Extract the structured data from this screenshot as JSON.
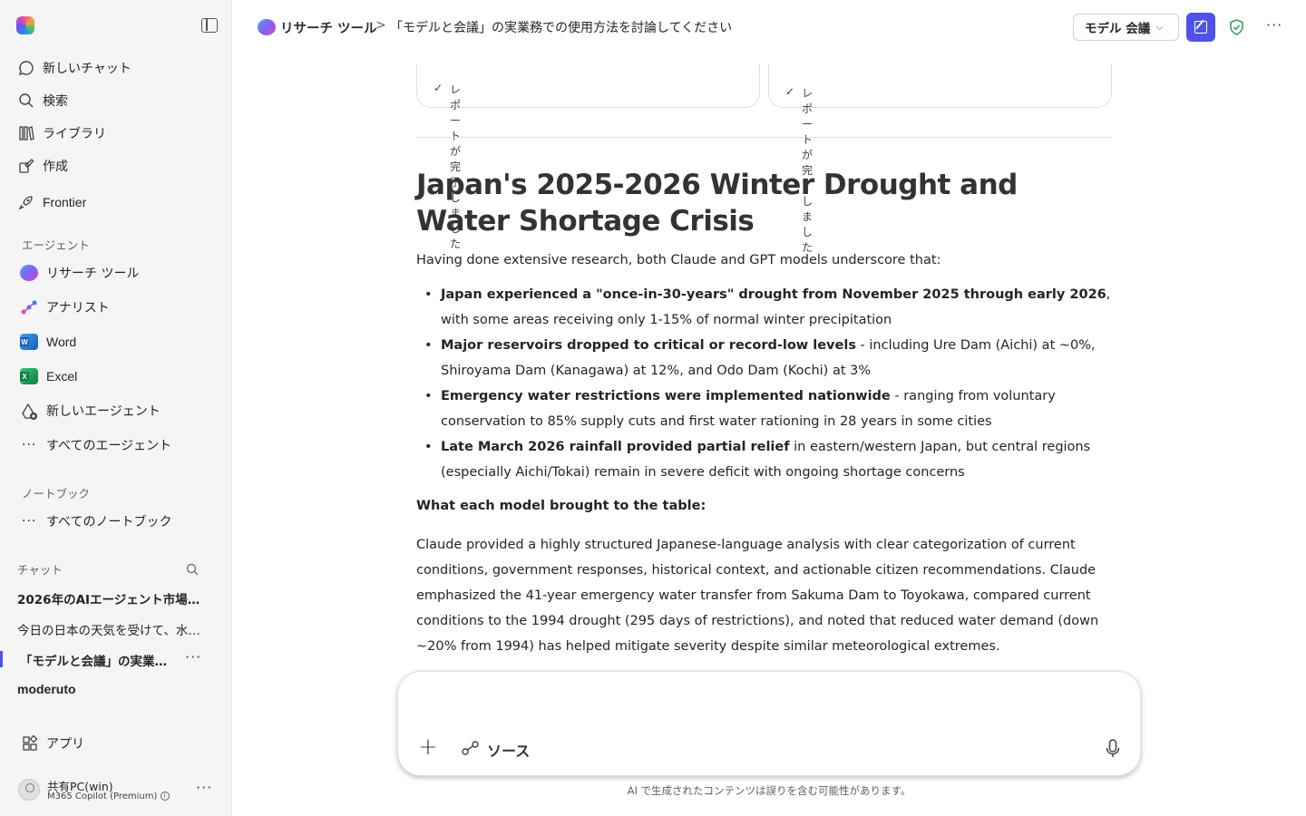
{
  "sidebar": {
    "nav": [
      {
        "label": "新しいチャット",
        "icon": "chat-icon"
      },
      {
        "label": "検索",
        "icon": "search-icon"
      },
      {
        "label": "ライブラリ",
        "icon": "library-icon"
      },
      {
        "label": "作成",
        "icon": "create-icon"
      },
      {
        "label": "Frontier",
        "icon": "rocket-icon"
      }
    ],
    "agents_heading": "エージェント",
    "agents": [
      {
        "label": "リサーチ ツール"
      },
      {
        "label": "アナリスト"
      },
      {
        "label": "Word"
      },
      {
        "label": "Excel"
      },
      {
        "label": "新しいエージェント"
      },
      {
        "label": "すべてのエージェント"
      }
    ],
    "notebooks_heading": "ノートブック",
    "all_notebooks": "すべてのノートブック",
    "chats_heading": "チャット",
    "chats": [
      {
        "label": "2026年のAIエージェント市場…"
      },
      {
        "label": "今日の日本の天気を受けて、水…"
      },
      {
        "label": "「モデルと会議」の実業…"
      },
      {
        "label": "moderuto"
      }
    ],
    "apps": "アプリ",
    "user": {
      "name": "共有PC(win)",
      "plan": "M365 Copilot (Premium)"
    }
  },
  "header": {
    "breadcrumb_root": "リサーチ ツール",
    "breadcrumb_sep": ">",
    "breadcrumb_title": "「モデルと会議」の実業務での使用方法を討論してください",
    "model_button": "モデル 会議"
  },
  "content": {
    "cards": [
      "レポートが完了しました",
      "レポートが完了しました"
    ],
    "title": "Japan's 2025-2026 Winter Drought and Water Shortage Crisis",
    "intro": "Having done extensive research, both Claude and GPT models underscore that:",
    "points": [
      {
        "bold": "Japan experienced a \"once-in-30-years\" drought from November 2025 through early 2026",
        "rest": ", with some areas receiving only 1-15% of normal winter precipitation"
      },
      {
        "bold": "Major reservoirs dropped to critical or record-low levels",
        "rest": " - including Ure Dam (Aichi) at ~0%, Shiroyama Dam (Kanagawa) at 12%, and Odo Dam (Kochi) at 3%"
      },
      {
        "bold": "Emergency water restrictions were implemented nationwide",
        "rest": " - ranging from voluntary conservation to 85% supply cuts and first water rationing in 28 years in some cities"
      },
      {
        "bold": "Late March 2026 rainfall provided partial relief",
        "rest": " in eastern/western Japan, but central regions (especially Aichi/Tokai) remain in severe deficit with ongoing shortage concerns"
      }
    ],
    "subheading": "What each model brought to the table:",
    "paragraph": "Claude provided a highly structured Japanese-language analysis with clear categorization of current conditions, government responses, historical context, and actionable citizen recommendations. Claude emphasized the 41-year emergency water transfer from Sakuma Dam to Toyokawa, compared current conditions to the 1994 drought (295 days of restrictions), and noted that reduced water demand (down ~20% from 1994) has helped mitigate severity despite similar meteorological extremes."
  },
  "composer": {
    "sources_label": "ソース",
    "disclaimer": "AI で生成されたコンテンツは誤りを含む可能性があります。"
  },
  "colors": {
    "accent": "#4f52e8",
    "shield": "#2e9e4f"
  }
}
